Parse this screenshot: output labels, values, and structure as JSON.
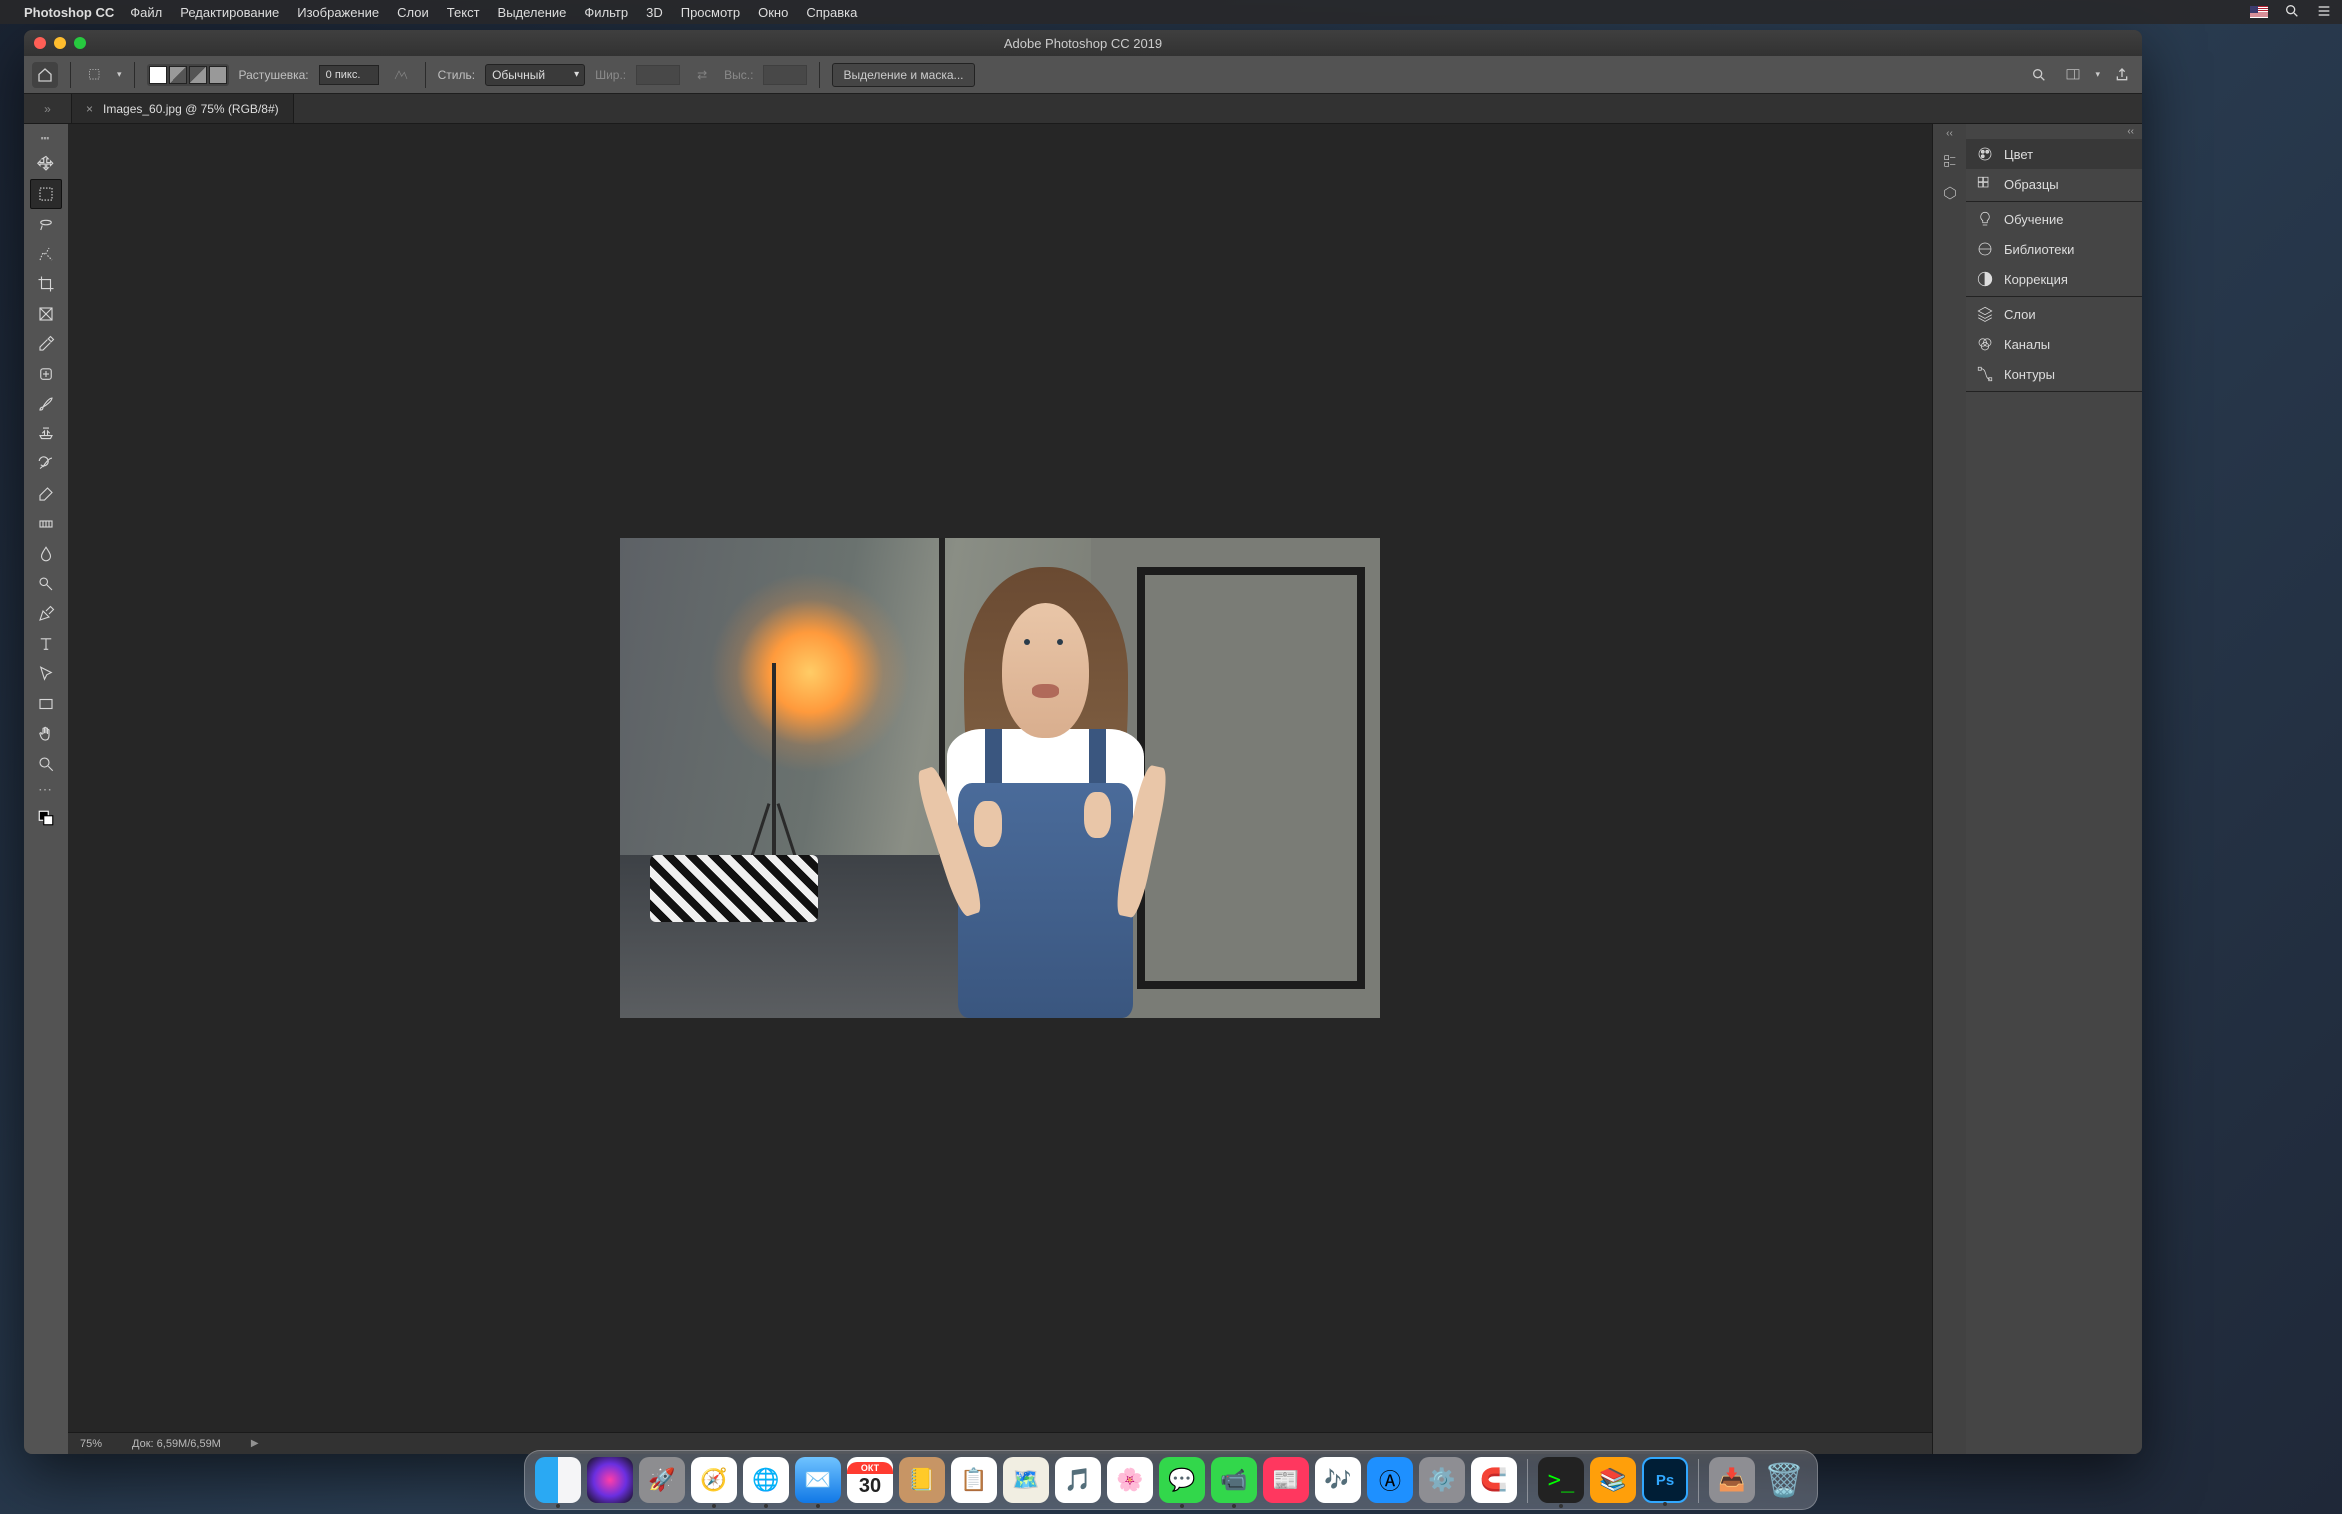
{
  "mac_menu": {
    "app_name": "Photoshop CC",
    "items": [
      "Файл",
      "Редактирование",
      "Изображение",
      "Слои",
      "Текст",
      "Выделение",
      "Фильтр",
      "3D",
      "Просмотр",
      "Окно",
      "Справка"
    ]
  },
  "window": {
    "title": "Adobe Photoshop CC 2019"
  },
  "options": {
    "feather_label": "Растушевка:",
    "feather_value": "0 пикс.",
    "style_label": "Стиль:",
    "style_value": "Обычный",
    "width_label": "Шир.:",
    "height_label": "Выс.:",
    "select_mask_label": "Выделение и маска..."
  },
  "doc_tab": {
    "title": "Images_60.jpg @ 75% (RGB/8#)"
  },
  "status": {
    "zoom": "75%",
    "doc_label": "Док: 6,59M/6,59M"
  },
  "panels": {
    "color": "Цвет",
    "swatches": "Образцы",
    "learn": "Обучение",
    "libraries": "Библиотеки",
    "adjustments": "Коррекция",
    "layers": "Слои",
    "channels": "Каналы",
    "paths": "Контуры"
  },
  "tools": [
    "move",
    "marquee",
    "lasso",
    "quick-select",
    "crop",
    "frame",
    "eyedropper",
    "healing",
    "brush",
    "clone",
    "history-brush",
    "eraser",
    "gradient",
    "blur",
    "dodge",
    "pen",
    "type",
    "path-select",
    "rectangle",
    "hand",
    "zoom"
  ],
  "calendar": {
    "month": "ОКТ",
    "day": "30"
  },
  "dock_running": [
    "finder",
    "safari",
    "chrome",
    "mail",
    "imessage",
    "facetime",
    "terminal",
    "photoshop"
  ]
}
